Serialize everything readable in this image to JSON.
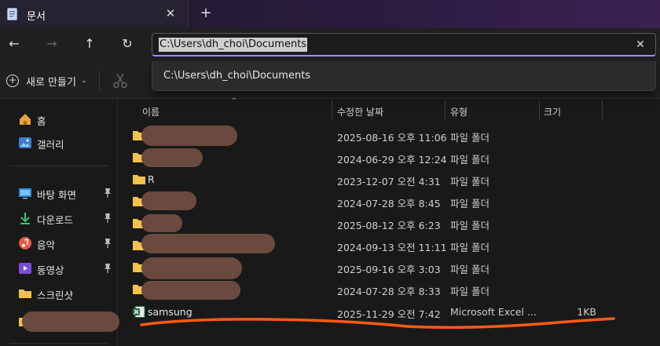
{
  "tab": {
    "title": "문서",
    "close_icon": "✕",
    "new_tab_icon": "+"
  },
  "nav": {
    "back": "←",
    "forward": "→",
    "up": "↑",
    "refresh": "↻"
  },
  "address": {
    "value": "C:\\Users\\dh_choi\\Documents",
    "clear_icon": "✕"
  },
  "suggestion": {
    "text": "C:\\Users\\dh_choi\\Documents"
  },
  "command_bar": {
    "new_label": "새로 만들기",
    "new_chevron": "⌄",
    "plus": "+"
  },
  "sidebar": {
    "items": [
      {
        "label": "홈",
        "icon": "home-icon"
      },
      {
        "label": "갤러리",
        "icon": "gallery-icon"
      },
      {
        "label": "바탕 화면",
        "icon": "desktop-icon",
        "pinned": true
      },
      {
        "label": "다운로드",
        "icon": "download-icon",
        "pinned": true
      },
      {
        "label": "음악",
        "icon": "music-icon",
        "pinned": true
      },
      {
        "label": "동영상",
        "icon": "video-icon",
        "pinned": true
      },
      {
        "label": "스크린샷",
        "icon": "folder-icon"
      },
      {
        "label": "",
        "icon": "folder-icon",
        "redacted": true
      }
    ]
  },
  "columns": {
    "name": "이름",
    "date": "수정한 날짜",
    "type": "유형",
    "size": "크기",
    "sort_indicator": "^"
  },
  "files": [
    {
      "name": "",
      "redacted": true,
      "date": "2025-08-16 오후 11:06",
      "type": "파일 폴더",
      "size": "",
      "kind": "folder"
    },
    {
      "name": "",
      "redacted": true,
      "date": "2024-06-29 오후 12:24",
      "type": "파일 폴더",
      "size": "",
      "kind": "folder"
    },
    {
      "name": "R",
      "redacted": false,
      "date": "2023-12-07 오전 4:31",
      "type": "파일 폴더",
      "size": "",
      "kind": "folder"
    },
    {
      "name": "",
      "redacted": true,
      "date": "2024-07-28 오후 8:45",
      "type": "파일 폴더",
      "size": "",
      "kind": "folder"
    },
    {
      "name": "",
      "redacted": true,
      "date": "2025-08-12 오후 6:23",
      "type": "파일 폴더",
      "size": "",
      "kind": "folder"
    },
    {
      "name": "",
      "redacted": true,
      "date": "2024-09-13 오전 11:11",
      "type": "파일 폴더",
      "size": "",
      "kind": "folder"
    },
    {
      "name": "",
      "redacted": true,
      "date": "2025-09-16 오후 3:03",
      "type": "파일 폴더",
      "size": "",
      "kind": "folder"
    },
    {
      "name": "",
      "redacted": true,
      "date": "2024-07-28 오후 8:33",
      "type": "파일 폴더",
      "size": "",
      "kind": "folder"
    },
    {
      "name": "samsung",
      "redacted": false,
      "date": "2025-11-29 오전 7:42",
      "type": "Microsoft Excel ...",
      "size": "1KB",
      "kind": "excel"
    }
  ],
  "colors": {
    "accent": "#9c8cff",
    "folder": "#f2c14e",
    "redaction": "#6a4a3e",
    "annotation": "#ff5a14",
    "excel": "#1d6f42"
  }
}
